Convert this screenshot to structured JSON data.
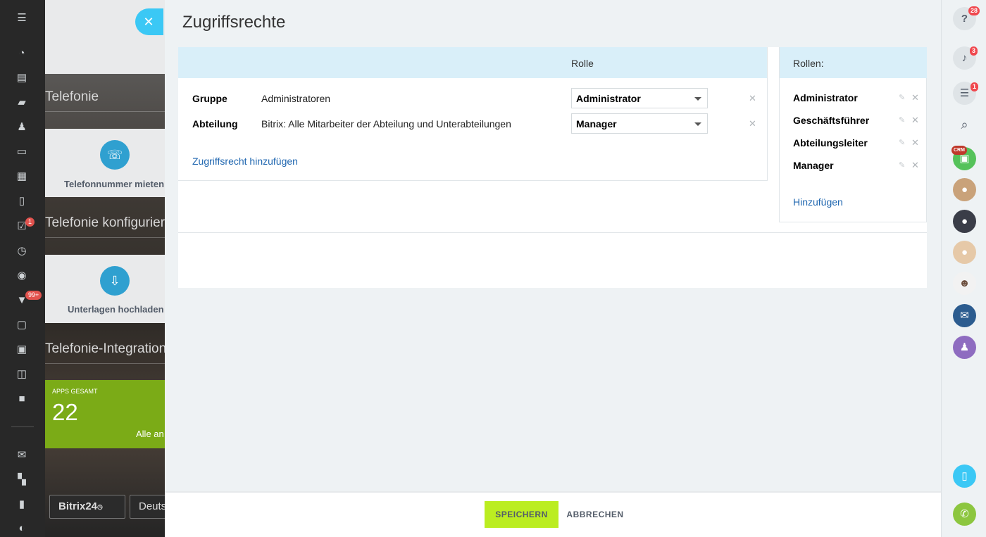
{
  "left_nav": {
    "badges": {
      "tasks": "1",
      "feed": "99+"
    }
  },
  "background": {
    "sections": [
      "Telefonie",
      "Telefonie konfigurieren",
      "Telefonie-Integration"
    ],
    "tiles": [
      "Telefonnummer mieten",
      "Unterlagen hochladen"
    ],
    "apps": {
      "label": "APPS GESAMT",
      "count": "22",
      "link": "Alle an"
    },
    "logo": "Bitrix24",
    "language": "Deutsch"
  },
  "panel": {
    "title": "Zugriffsrechte",
    "table_header": "Rolle",
    "rows": [
      {
        "type": "Gruppe",
        "name": "Administratoren",
        "role": "Administrator"
      },
      {
        "type": "Abteilung",
        "name": "Bitrix: Alle Mitarbeiter der Abteilung und Unterabteilungen",
        "role": "Manager"
      }
    ],
    "add_access": "Zugriffsrecht hinzufügen",
    "roles": {
      "header": "Rollen:",
      "items": [
        "Administrator",
        "Geschäftsführer",
        "Abteilungsleiter",
        "Manager"
      ],
      "add": "Hinzufügen"
    },
    "footer": {
      "save": "SPEICHERN",
      "cancel": "ABBRECHEN"
    }
  },
  "right_bar": {
    "help_badge": "28",
    "notifications_badge": "3",
    "messages_badge": "1",
    "crm_label": "CRM"
  },
  "colors": {
    "accent": "#3bc8f5",
    "save": "#bbed21",
    "link": "#2067b0",
    "header": "#d9eff9"
  }
}
